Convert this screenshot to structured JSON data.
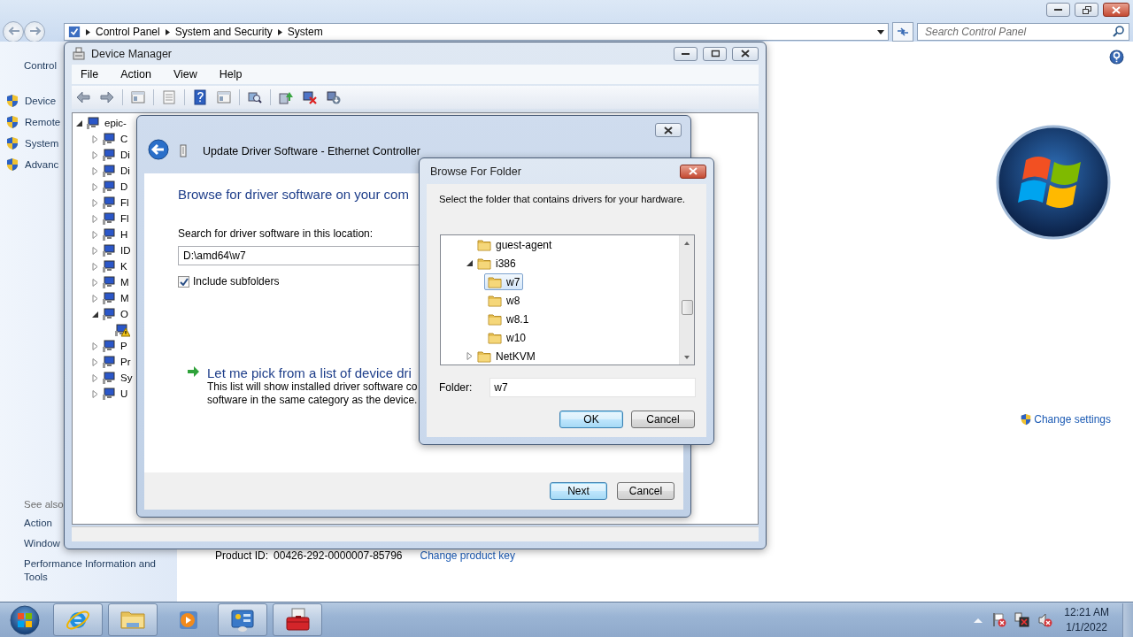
{
  "control_panel": {
    "breadcrumb": [
      "Control Panel",
      "System and Security",
      "System"
    ],
    "search": {
      "placeholder": "Search Control Panel"
    },
    "sidebar": {
      "home": "Control",
      "tasks": [
        "Device",
        "Remote",
        "System",
        "Advanc"
      ],
      "see_also_heading": "See also",
      "see_also": [
        "Action",
        "Window",
        "Performance Information and Tools"
      ]
    },
    "change_settings": "Change settings",
    "product_id_label": "Product ID:",
    "product_id": "00426-292-0000007-85796",
    "change_product_key": "Change product key"
  },
  "device_manager": {
    "title": "Device Manager",
    "menu": [
      "File",
      "Action",
      "View",
      "Help"
    ],
    "tree": {
      "label": "epic-",
      "expanded": true,
      "children": [
        {
          "label": "C",
          "expanded": false
        },
        {
          "label": "Di",
          "expanded": false
        },
        {
          "label": "Di",
          "expanded": false
        },
        {
          "label": "D",
          "expanded": false
        },
        {
          "label": "Fl",
          "expanded": false
        },
        {
          "label": "Fl",
          "expanded": false
        },
        {
          "label": "H",
          "expanded": false
        },
        {
          "label": "ID",
          "expanded": false
        },
        {
          "label": "K",
          "expanded": false
        },
        {
          "label": "M",
          "expanded": false
        },
        {
          "label": "M",
          "expanded": false
        },
        {
          "label": "O",
          "expanded": true,
          "children": [
            {
              "warning": true
            }
          ]
        },
        {
          "label": "P",
          "expanded": false
        },
        {
          "label": "Pr",
          "expanded": false
        },
        {
          "label": "Sy",
          "expanded": false
        },
        {
          "label": "U",
          "expanded": false
        }
      ]
    }
  },
  "update_driver": {
    "title": "Update Driver Software - Ethernet Controller",
    "heading": "Browse for driver software on your com",
    "location_label": "Search for driver software in this location:",
    "location_value": "D:\\amd64\\w7",
    "include_subfolders": {
      "label": "Include subfolders",
      "checked": true
    },
    "pick": {
      "title": "Let me pick from a list of device dri",
      "description": [
        "This list will show installed driver software co",
        "software in the same category as the device."
      ]
    },
    "buttons": [
      {
        "label": "Next",
        "default": true
      },
      {
        "label": "Cancel",
        "default": false
      }
    ]
  },
  "browse_folder": {
    "title": "Browse For Folder",
    "instruction": "Select the folder that contains drivers for your hardware.",
    "tree": [
      {
        "label": "guest-agent",
        "selected": false
      },
      {
        "label": "i386",
        "selected": false,
        "expanded": true,
        "children": [
          {
            "label": "w7",
            "selected": true
          },
          {
            "label": "w8",
            "selected": false
          },
          {
            "label": "w8.1",
            "selected": false
          },
          {
            "label": "w10",
            "selected": false
          }
        ]
      },
      {
        "label": "NetKVM",
        "selected": false,
        "expanded": false
      }
    ],
    "folder_label": "Folder:",
    "folder_value": "w7",
    "buttons": [
      {
        "label": "OK",
        "default": true
      },
      {
        "label": "Cancel",
        "default": false
      }
    ]
  },
  "taskbar": {
    "buttons": [
      {
        "running": true
      },
      {
        "running": true
      },
      {
        "running": false
      },
      {
        "running": true
      },
      {
        "running": true
      }
    ],
    "clock": {
      "time": "12:21 AM",
      "date": "1/1/2022"
    }
  }
}
